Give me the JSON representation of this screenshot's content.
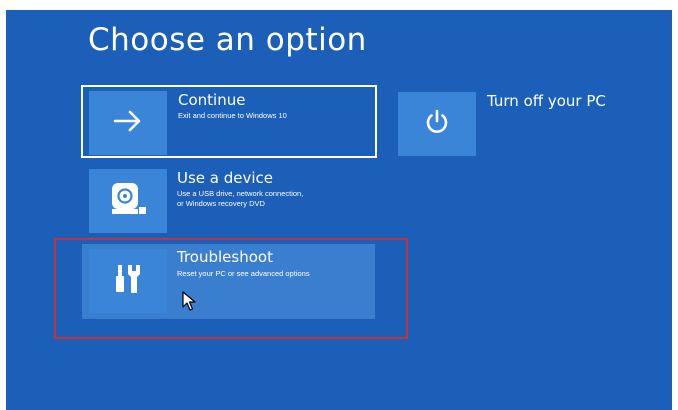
{
  "screen": {
    "heading": "Choose an option",
    "background_color": "#1b5fb8",
    "tile_color": "#3a85d8",
    "highlight_color": "#c5323a"
  },
  "options": [
    {
      "id": "continue",
      "title": "Continue",
      "description": "Exit and continue to Windows 10",
      "icon": "arrow-right-icon",
      "focused": true
    },
    {
      "id": "turn-off",
      "title": "Turn off your PC",
      "icon": "power-icon"
    },
    {
      "id": "use-device",
      "title": "Use a device",
      "description_lines": [
        "Use a USB drive, network connection,",
        "or Windows recovery DVD"
      ],
      "icon": "disc-drive-icon"
    },
    {
      "id": "troubleshoot",
      "title": "Troubleshoot",
      "description": "Reset your PC or see advanced options",
      "icon": "tools-icon",
      "hovered": true,
      "highlighted": true
    }
  ],
  "cursor": {
    "icon": "mouse-pointer-icon"
  }
}
